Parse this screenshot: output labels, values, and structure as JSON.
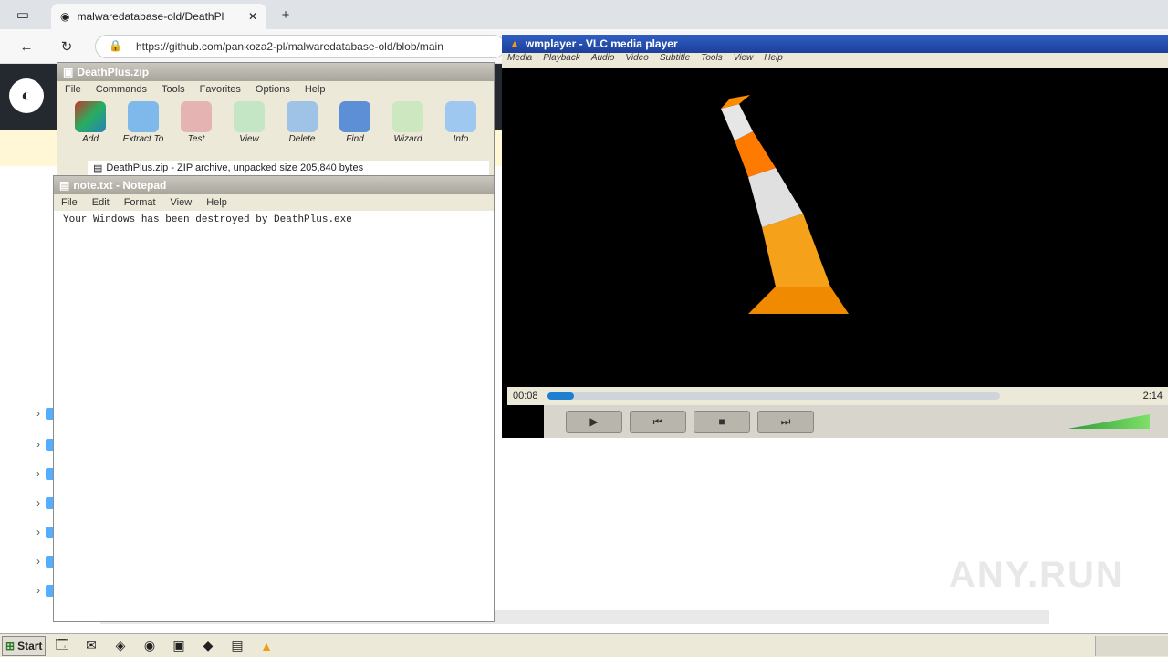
{
  "browser": {
    "tab_title": "malwaredatabase-old/DeathPl",
    "url": "https://github.com/pankoza2-pl/malwaredatabase-old/blob/main",
    "new_tab": "+"
  },
  "winrar": {
    "title": "DeathPlus.zip",
    "menu": [
      "File",
      "Commands",
      "Tools",
      "Favorites",
      "Options",
      "Help"
    ],
    "tools": [
      "Add",
      "Extract To",
      "Test",
      "View",
      "Delete",
      "Find",
      "Wizard",
      "Info"
    ],
    "status": "DeathPlus.zip - ZIP archive, unpacked size 205,840 bytes"
  },
  "notepad": {
    "title": "note.txt - Notepad",
    "menu": [
      "File",
      "Edit",
      "Format",
      "View",
      "Help"
    ],
    "text": "Your Windows has been destroyed by DeathPlus.exe"
  },
  "player": {
    "title": "wmplayer - VLC media player",
    "menu": [
      "Media",
      "Playback",
      "Audio",
      "Video",
      "Subtitle",
      "Tools",
      "View",
      "Help"
    ],
    "time_elapsed": "00:08",
    "time_total": "2:14",
    "progress": 0.06
  },
  "taskbar": {
    "start_label": "Start"
  },
  "watermark": "ANY.RUN",
  "colors": {
    "github_header": "#24292f",
    "banner": "#fff7d6",
    "seek_fill": "#1e7fd1"
  }
}
